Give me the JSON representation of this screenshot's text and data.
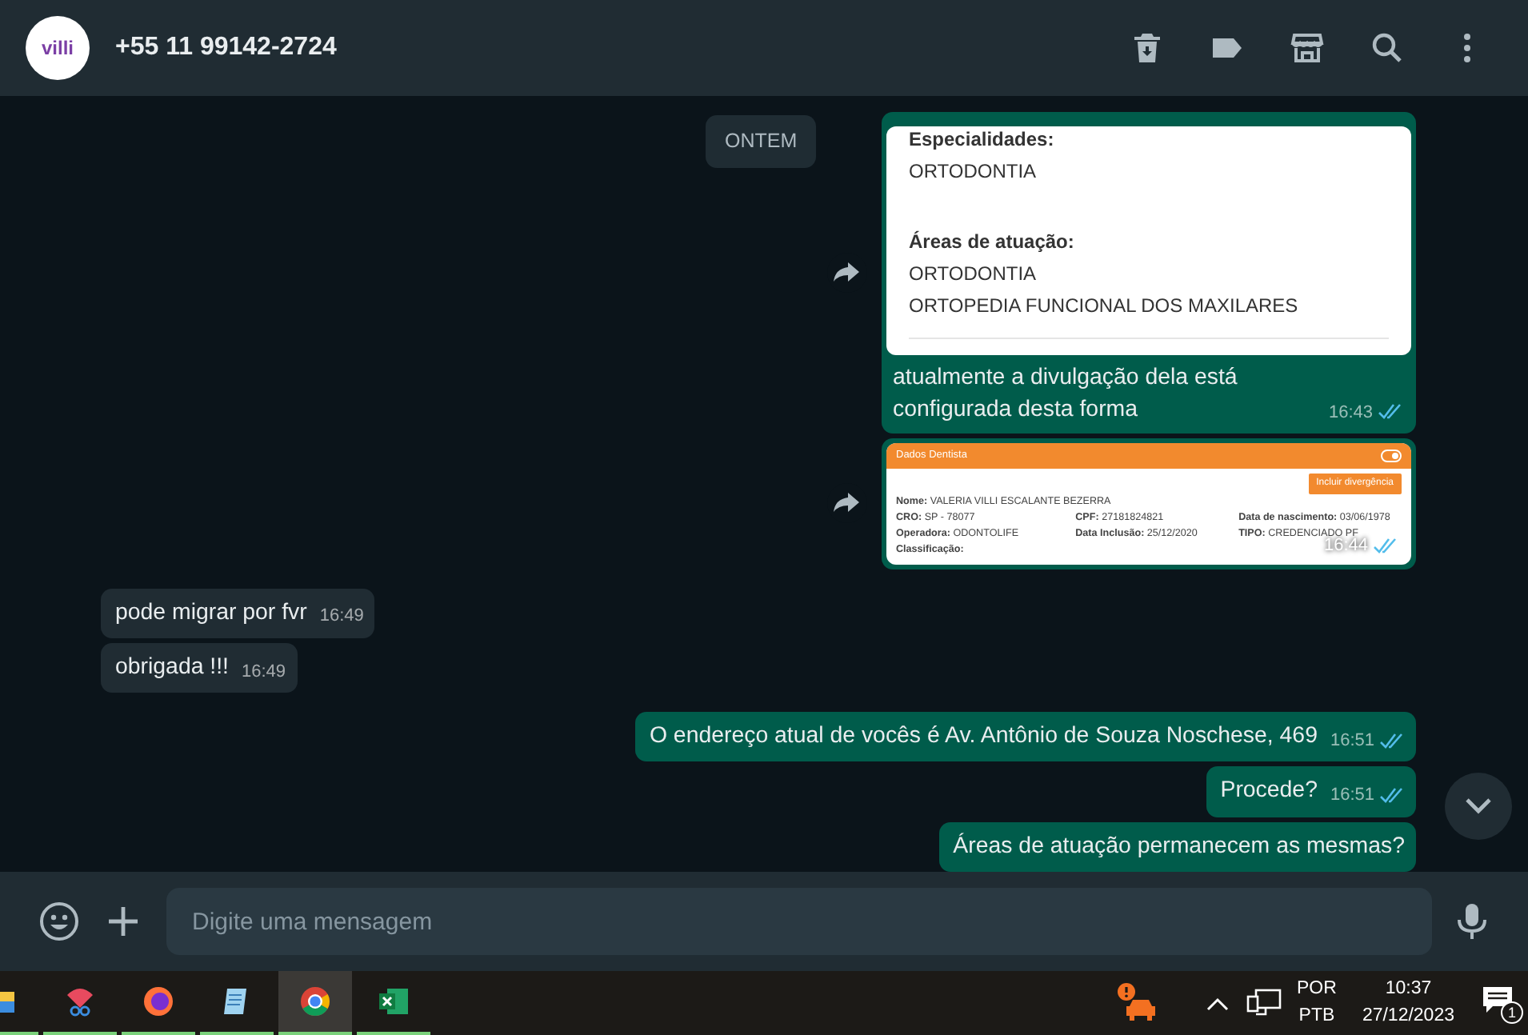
{
  "header": {
    "contact": "+55 11 99142-2724",
    "avatar_text": "villi"
  },
  "date_pill": "ONTEM",
  "messages": [
    {
      "kind": "doc",
      "read": true,
      "time": "16:43",
      "caption": "atualmente a divulgação dela está configurada desta forma",
      "sections": [
        {
          "heading": "Especialidades:",
          "lines": [
            "ORTODONTIA"
          ]
        },
        {
          "heading": "Áreas de atuação:",
          "lines": [
            "ORTODONTIA",
            "ORTOPEDIA FUNCIONAL DOS MAXILARES"
          ]
        }
      ]
    },
    {
      "kind": "form",
      "read": true,
      "time": "16:44",
      "title": "Dados Dentista",
      "toggle_on": true,
      "action": "Incluir divergência",
      "fields": [
        "**Nome:** VALERIA VILLI ESCALANTE BEZERRA",
        "**CRO:** SP - 78077",
        "**CPF:** 27181824821",
        "**Data de nascimento:** 03/06/1978",
        "**Operadora:** ODONTOLIFE",
        "**Data Inclusão:** 25/12/2020",
        "**TIPO:** CREDENCIADO PF",
        "**Classificação:**"
      ]
    },
    {
      "kind": "incoming",
      "text": "pode migrar por fvr",
      "time": "16:49"
    },
    {
      "kind": "incoming",
      "text": "obrigada !!!",
      "time": "16:49"
    },
    {
      "kind": "outgoing",
      "read": true,
      "text": "O endereço atual de vocês é Av. Antônio de Souza Noschese, 469",
      "time": "16:51"
    },
    {
      "kind": "outgoing",
      "read": true,
      "text": "Procede?",
      "time": "16:51"
    },
    {
      "kind": "outgoing",
      "text": "Áreas de atuação permanecem as mesmas?"
    }
  ],
  "composer": {
    "placeholder": "Digite uma mensagem"
  },
  "taskbar": {
    "apps": [
      {
        "kind": "folder",
        "selected": false
      },
      {
        "kind": "snip",
        "selected": false
      },
      {
        "kind": "firefox",
        "selected": false
      },
      {
        "kind": "notepad",
        "selected": false
      },
      {
        "kind": "chrome",
        "selected": true
      },
      {
        "kind": "excel",
        "selected": false
      }
    ],
    "lang_top": "POR",
    "lang_bottom": "PTB",
    "time": "10:37",
    "date": "27/12/2023",
    "notifications": "1"
  }
}
